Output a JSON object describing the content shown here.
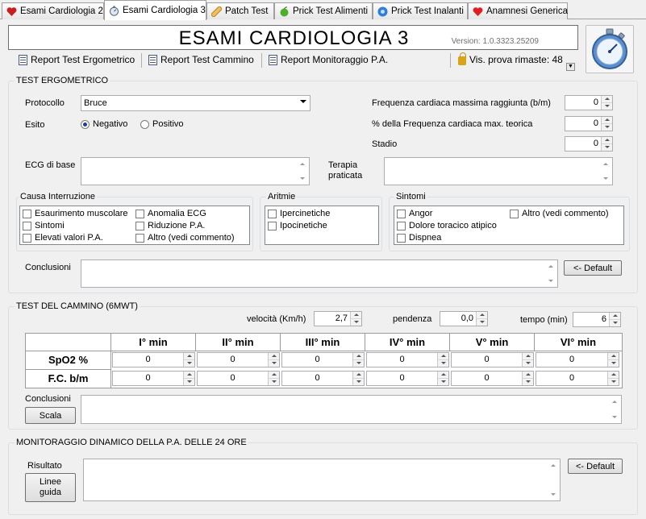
{
  "tabs": [
    {
      "label": "Esami Cardiologia 2",
      "icon": "heart-icon",
      "active": false
    },
    {
      "label": "Esami Cardiologia 3",
      "icon": "stopwatch-icon",
      "active": true
    },
    {
      "label": "Patch Test",
      "icon": "patch-icon",
      "active": false
    },
    {
      "label": "Prick Test Alimenti",
      "icon": "apple-icon",
      "active": false
    },
    {
      "label": "Prick Test Inalanti",
      "icon": "flower-icon",
      "active": false
    },
    {
      "label": "Anamnesi Generica",
      "icon": "heart-icon",
      "active": false
    }
  ],
  "header": {
    "title": "ESAMI CARDIOLOGIA 3",
    "version": "Version: 1.0.3323.25209"
  },
  "toolbar": {
    "report_ergometrico": "Report Test Ergometrico",
    "report_cammino": "Report Test Cammino",
    "report_monitoraggio": "Report Monitoraggio P.A.",
    "trial_visits": "Vis. prova rimaste: 48"
  },
  "ergometrico": {
    "section_title": "TEST ERGOMETRICO",
    "protocollo_label": "Protocollo",
    "protocollo_value": "Bruce",
    "esito_label": "Esito",
    "esito_negativo": "Negativo",
    "esito_positivo": "Positivo",
    "esito_selected": "Negativo",
    "freq_max_label": "Frequenza cardiaca massima raggiunta (b/m)",
    "freq_max_value": "0",
    "perc_freq_label": "% della Frequenza cardiaca max. teorica",
    "perc_freq_value": "0",
    "stadio_label": "Stadio",
    "stadio_value": "0",
    "ecg_label": "ECG di base",
    "terapia_label": "Terapia praticata",
    "causa_title": "Causa Interruzione",
    "causa_items": [
      "Esaurimento muscolare",
      "Sintomi",
      "Elevati valori P.A.",
      "Anomalia ECG",
      "Riduzione P.A.",
      "Altro (vedi commento)"
    ],
    "aritmie_title": "Aritmie",
    "aritmie_items": [
      "Ipercinetiche",
      "Ipocinetiche"
    ],
    "sintomi_title": "Sintomi",
    "sintomi_items": [
      "Angor",
      "Dolore toracico atipico",
      "Dispnea",
      "Altro (vedi commento)"
    ],
    "conclusioni_label": "Conclusioni",
    "default_button": "<- Default"
  },
  "cammino": {
    "section_title": "TEST DEL CAMMINO (6MWT)",
    "velocita_label": "velocità (Km/h)",
    "velocita_value": "2,7",
    "pendenza_label": "pendenza",
    "pendenza_value": "0,0",
    "tempo_label": "tempo (min)",
    "tempo_value": "6",
    "columns": [
      "I° min",
      "II° min",
      "III° min",
      "IV° min",
      "V° min",
      "VI° min"
    ],
    "rows": [
      {
        "label": "SpO2 %",
        "values": [
          "0",
          "0",
          "0",
          "0",
          "0",
          "0"
        ]
      },
      {
        "label": "F.C. b/m",
        "values": [
          "0",
          "0",
          "0",
          "0",
          "0",
          "0"
        ]
      }
    ],
    "conclusioni_label": "Conclusioni",
    "scala_button": "Scala"
  },
  "monitoraggio": {
    "section_title": "MONITORAGGIO DINAMICO DELLA P.A. DELLE 24 ORE",
    "risultato_label": "Risultato",
    "linee_guida_button": "Linee guida",
    "default_button": "<- Default"
  },
  "colors": {
    "window_bg": "#f0f0f0",
    "group_border": "#d5dfe5",
    "radio_dot": "#1a3f9a",
    "lock": "#d8a418"
  }
}
